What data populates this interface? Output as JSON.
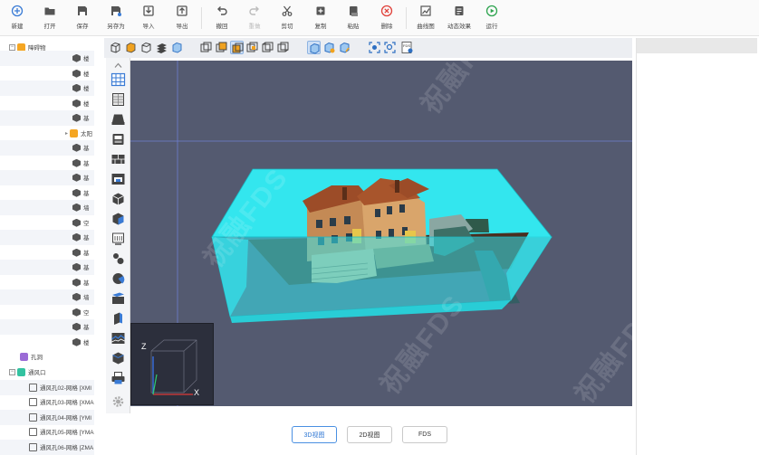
{
  "toolbar": {
    "items": [
      {
        "label": "新建",
        "icon": "plus-circle-icon"
      },
      {
        "label": "打开",
        "icon": "folder-icon"
      },
      {
        "label": "保存",
        "icon": "save-icon"
      },
      {
        "label": "另存为",
        "icon": "save-as-icon"
      },
      {
        "label": "导入",
        "icon": "import-icon"
      },
      {
        "label": "导出",
        "icon": "export-icon"
      },
      {
        "label": "撤回",
        "icon": "undo-icon"
      },
      {
        "label": "重做",
        "icon": "redo-icon"
      },
      {
        "label": "剪切",
        "icon": "scissors-icon"
      },
      {
        "label": "复制",
        "icon": "copy-icon"
      },
      {
        "label": "粘贴",
        "icon": "paste-icon"
      },
      {
        "label": "删除",
        "icon": "delete-icon"
      },
      {
        "label": "曲线图",
        "icon": "line-chart-icon"
      },
      {
        "label": "动态效果",
        "icon": "animation-icon"
      },
      {
        "label": "运行",
        "icon": "run-icon"
      }
    ]
  },
  "tree": {
    "root_label": "障碍物",
    "rows": [
      "楼",
      "楼",
      "楼",
      "楼",
      "基",
      "太阳",
      "基",
      "基",
      "基",
      "基",
      "墙",
      "空",
      "基",
      "基",
      "基",
      "基",
      "墙",
      "空",
      "基",
      "楼"
    ],
    "holes_label": "孔洞",
    "vents_label": "通风口",
    "vents": [
      "通风孔02-网格 [XMI",
      "通风孔03-网格 [XMA",
      "通风孔04-网格 [YMI",
      "通风孔05-网格 [YMA",
      "通风孔06-网格 [ZMA"
    ]
  },
  "axes": {
    "z": "Z",
    "x": "X"
  },
  "watermark": "祝融FDS",
  "view_tabs": [
    "3D视图",
    "2D视图",
    "FDS"
  ],
  "colors": {
    "accent": "#4a90e2",
    "domain_box": "#33e6ee",
    "viewport_bg": "#545a70"
  }
}
